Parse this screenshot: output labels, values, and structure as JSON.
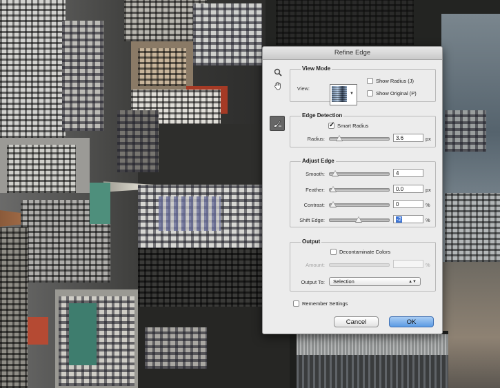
{
  "dialog": {
    "title": "Refine Edge",
    "tools": {
      "zoom_icon": "zoom-icon",
      "hand_icon": "hand-icon",
      "brush_icon": "refine-radius-brush-icon"
    },
    "view_mode": {
      "legend": "View Mode",
      "view_label": "View:",
      "show_radius": {
        "label": "Show Radius (J)",
        "checked": false
      },
      "show_original": {
        "label": "Show Original (P)",
        "checked": false
      }
    },
    "edge_detection": {
      "legend": "Edge Detection",
      "smart_radius": {
        "label": "Smart Radius",
        "checked": true
      },
      "radius": {
        "label": "Radius:",
        "value": "3.6",
        "unit": "px",
        "fraction": 0.12
      }
    },
    "adjust_edge": {
      "legend": "Adjust Edge",
      "smooth": {
        "label": "Smooth:",
        "value": "4",
        "unit": "",
        "fraction": 0.04
      },
      "feather": {
        "label": "Feather:",
        "value": "0.0",
        "unit": "px",
        "fraction": 0.0
      },
      "contrast": {
        "label": "Contrast:",
        "value": "0",
        "unit": "%",
        "fraction": 0.0
      },
      "shift_edge": {
        "label": "Shift Edge:",
        "value": "-2",
        "unit": "%",
        "fraction": 0.49
      }
    },
    "output": {
      "legend": "Output",
      "decontaminate": {
        "label": "Decontaminate Colors",
        "checked": false
      },
      "amount": {
        "label": "Amount:",
        "value": "",
        "unit": "%"
      },
      "output_to": {
        "label": "Output To:",
        "value": "Selection"
      }
    },
    "remember": {
      "label": "Remember Settings",
      "checked": false
    },
    "buttons": {
      "cancel": "Cancel",
      "ok": "OK"
    }
  }
}
